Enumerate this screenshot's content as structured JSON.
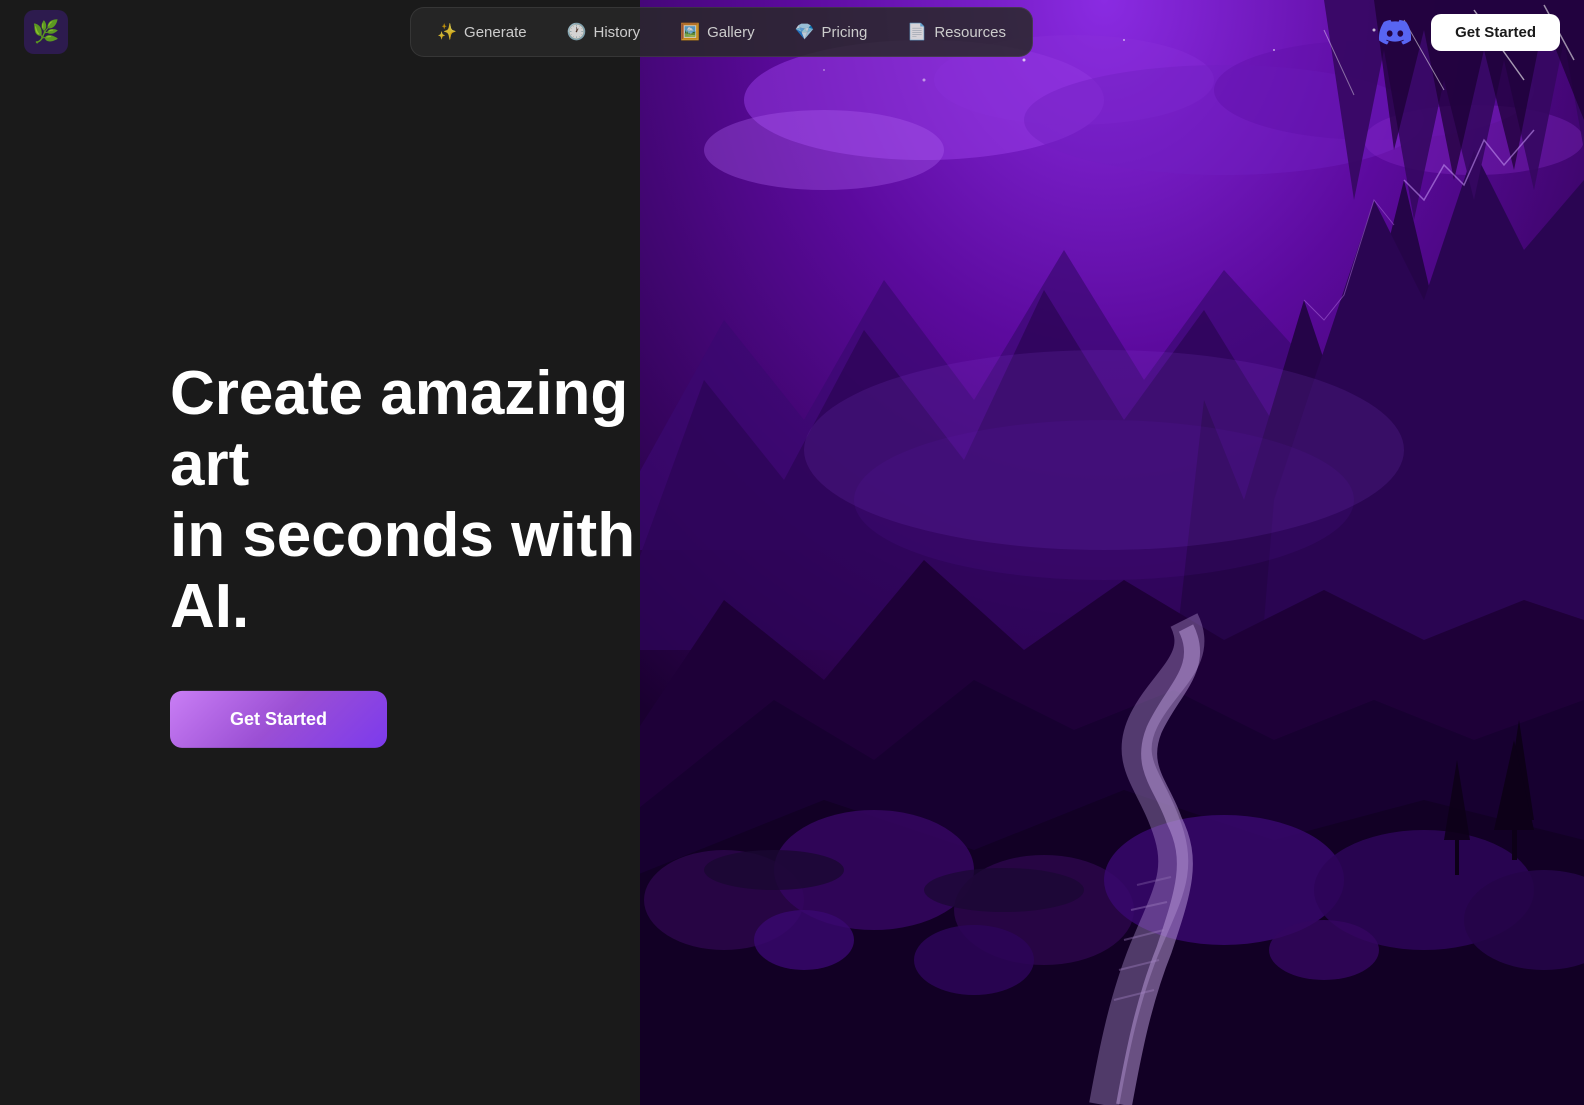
{
  "brand": {
    "logo_emoji": "🌿",
    "logo_bg": "#2d1b4e"
  },
  "navbar": {
    "items": [
      {
        "id": "generate",
        "label": "Generate",
        "icon": "✨"
      },
      {
        "id": "history",
        "label": "History",
        "icon": "🕐"
      },
      {
        "id": "gallery",
        "label": "Gallery",
        "icon": "🖼️"
      },
      {
        "id": "pricing",
        "label": "Pricing",
        "icon": "💎"
      },
      {
        "id": "resources",
        "label": "Resources",
        "icon": "📄"
      }
    ],
    "get_started_label": "Get Started"
  },
  "hero": {
    "headline_line1": "Create amazing art",
    "headline_line2": "in seconds with AI.",
    "cta_label": "Get Started"
  },
  "colors": {
    "bg_dark": "#1a1a1a",
    "accent_purple": "#7c3aed",
    "button_white": "#ffffff",
    "text_white": "#ffffff",
    "text_gray": "#cccccc"
  }
}
